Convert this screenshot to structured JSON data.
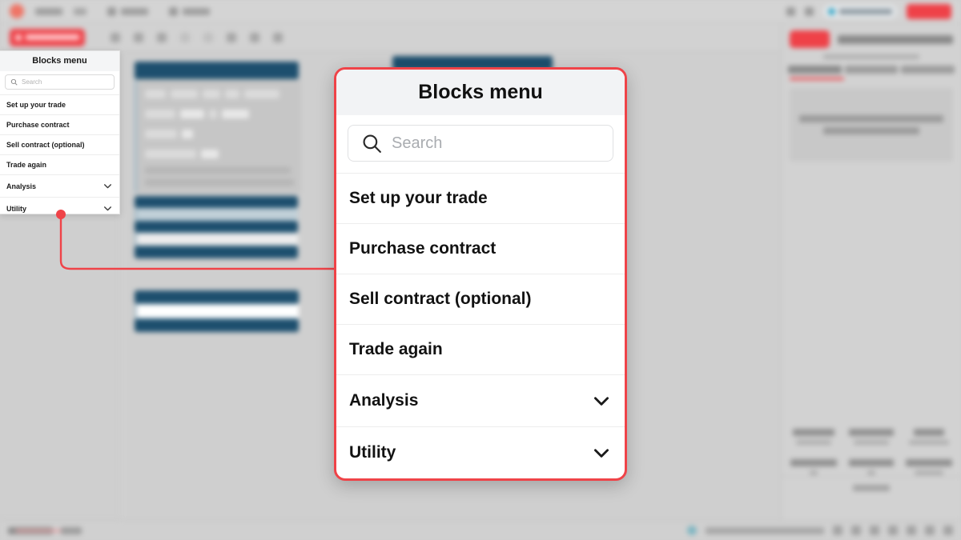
{
  "window": {
    "canvas_bg": "#cfcfcf",
    "accent_red": "#ef4148",
    "block_blue": "#1d4f6e"
  },
  "blocks_menu": {
    "title": "Blocks menu",
    "search": {
      "placeholder": "Search",
      "value": "",
      "icon": "search-icon"
    },
    "items": [
      {
        "label": "Set up your trade",
        "expandable": false
      },
      {
        "label": "Purchase contract",
        "expandable": false
      },
      {
        "label": "Sell contract (optional)",
        "expandable": false
      },
      {
        "label": "Trade again",
        "expandable": false
      },
      {
        "label": "Analysis",
        "expandable": true,
        "icon": "chevron-down-icon"
      },
      {
        "label": "Utility",
        "expandable": true,
        "icon": "chevron-down-icon"
      }
    ]
  },
  "callout": {
    "marker": "callout-dot",
    "line_color": "#ef4348"
  }
}
